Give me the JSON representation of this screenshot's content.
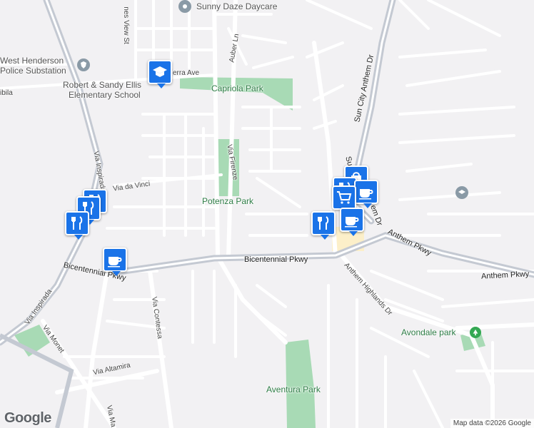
{
  "map": {
    "places": {
      "daycare": "Sunny Daze Daycare",
      "police": "West Henderson Police Substation",
      "police_line1": "West Henderson",
      "police_line2": "Police Substation",
      "school_line1": "Robert & Sandy Ellis",
      "school_line2": "Elementary School"
    },
    "parks": {
      "capriola": "Capriola Park",
      "potenza": "Potenza Park",
      "avondale": "Avondale park",
      "aventura": "Aventura Park"
    },
    "streets": {
      "dunes_view": "nes View St",
      "auber": "Auber Ln",
      "serra": "erra Ave",
      "abila": "ibila",
      "via_firenze": "Via Firenze",
      "via_da_vinci": "Via da Vinci",
      "via_inspirada_north": "Via Inspirada",
      "via_inspirada_south": "Via Inspirada",
      "bicentennial_west": "Bicentennial Pkwy",
      "bicentennial_east": "Bicentennial Pkwy",
      "sun_city_anthem": "Sun City Anthem Dr",
      "sun_city_anthem_short": "Su",
      "anthem_dr_partial": "em Dr",
      "anthem_pkwy_1": "Anthem Pkwy",
      "anthem_pkwy_2": "Anthem Pkwy",
      "anthem_highlands": "Anthem Highlands Dr",
      "via_contessa": "Via Contessa",
      "via_monet": "Via Monet",
      "via_altamira": "Via Altamira",
      "via_ma": "Via Ma"
    },
    "markers": [
      {
        "name": "school-marker",
        "icon": "school-icon"
      },
      {
        "name": "restaurant-marker",
        "icon": "restaurant-icon"
      },
      {
        "name": "cafe-marker",
        "icon": "coffee-cup-icon"
      },
      {
        "name": "grocery-marker",
        "icon": "shopping-cart-icon"
      }
    ],
    "colors": {
      "background": "#f2f1f3",
      "road": "#ffffff",
      "highway": "#c4c9d2",
      "park": "#a8dab5",
      "marker": "#1a73e8",
      "commercial": "#fcefc9"
    }
  },
  "branding": {
    "logo": "Google",
    "attribution": "Map data ©2026 Google"
  }
}
